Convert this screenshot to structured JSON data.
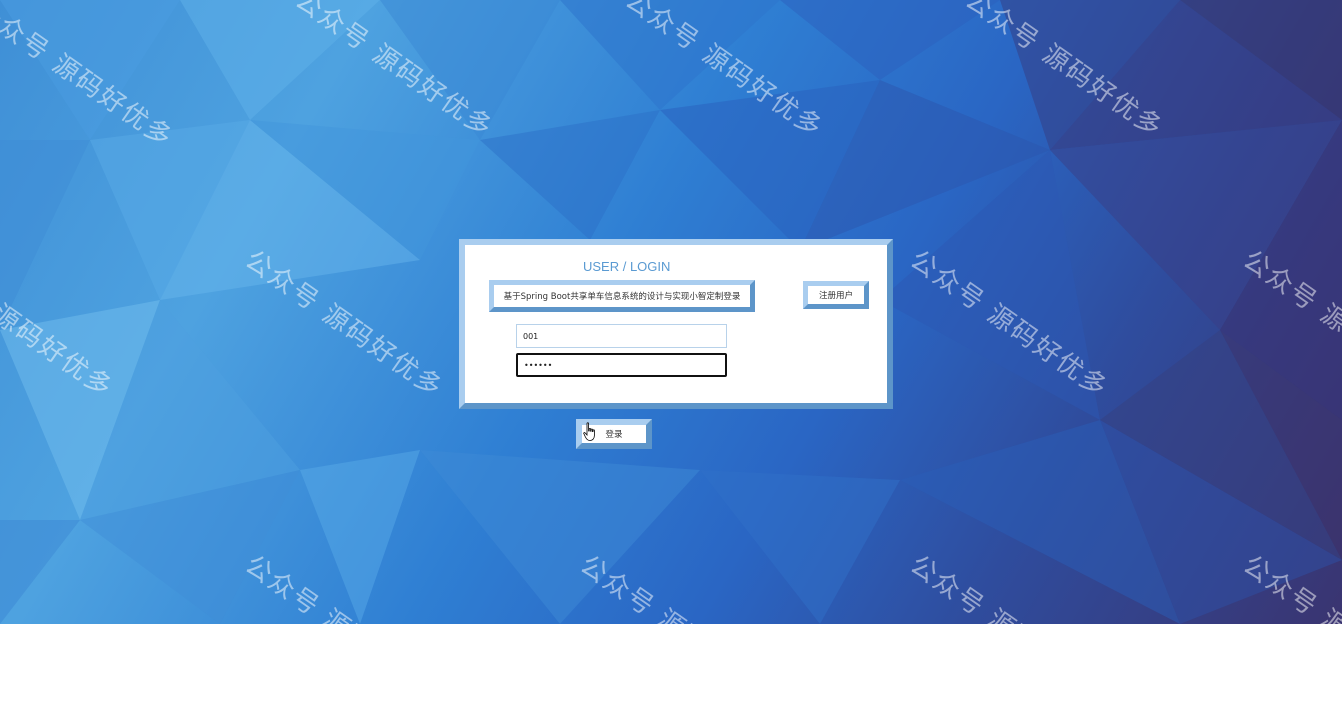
{
  "login": {
    "title": "USER / LOGIN",
    "system_title": "基于Spring Boot共享单车信息系统的设计与实现小智定制登录",
    "register_label": "注册用户",
    "username_value": "001",
    "password_value": "••••••",
    "login_label": "登录"
  },
  "watermark": {
    "text": "公众号 源码好优多"
  },
  "colors": {
    "panel_border": "#7fb2de",
    "title_text": "#5a9ad2",
    "background_start": "#3f8fd6",
    "background_end": "#3a3470"
  },
  "icons": {
    "cursor": "hand-pointer-icon"
  }
}
